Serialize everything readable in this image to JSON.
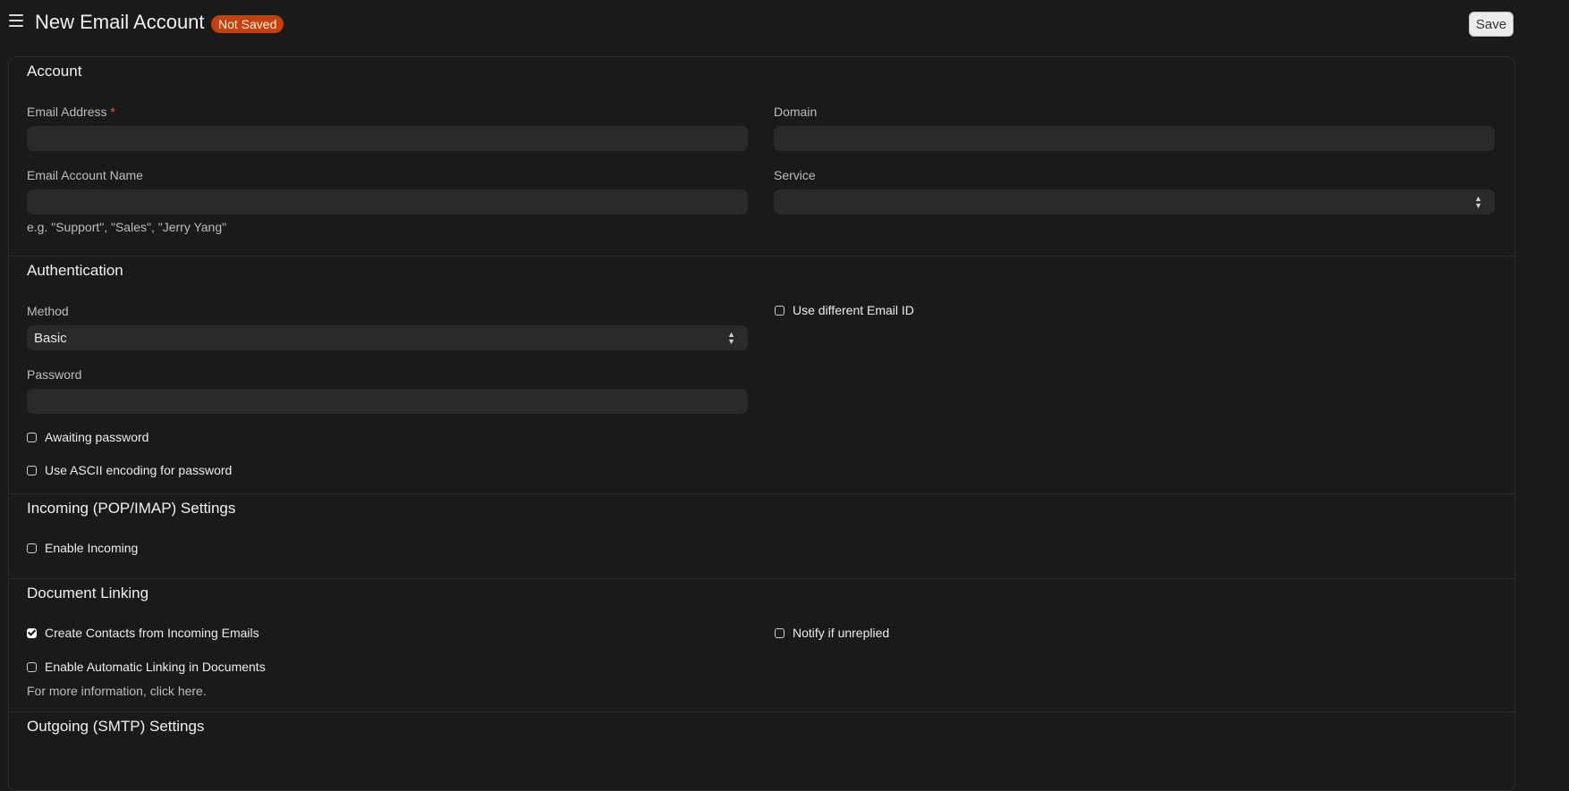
{
  "header": {
    "title": "New Email Account",
    "status": "Not Saved",
    "save_label": "Save"
  },
  "account": {
    "section_title": "Account",
    "email_address_label": "Email Address",
    "required_marker": "*",
    "email_address_value": "",
    "domain_label": "Domain",
    "domain_value": "",
    "account_name_label": "Email Account Name",
    "account_name_value": "",
    "account_name_help": "e.g. \"Support\", \"Sales\", \"Jerry Yang\"",
    "service_label": "Service",
    "service_value": ""
  },
  "authentication": {
    "section_title": "Authentication",
    "method_label": "Method",
    "method_value": "Basic",
    "password_label": "Password",
    "password_value": "",
    "awaiting_password_label": "Awaiting password",
    "awaiting_password_checked": false,
    "ascii_encoding_label": "Use ASCII encoding for password",
    "ascii_encoding_checked": false,
    "use_different_email_label": "Use different Email ID",
    "use_different_email_checked": false
  },
  "incoming": {
    "section_title": "Incoming (POP/IMAP) Settings",
    "enable_incoming_label": "Enable Incoming",
    "enable_incoming_checked": false
  },
  "document_linking": {
    "section_title": "Document Linking",
    "create_contacts_label": "Create Contacts from Incoming Emails",
    "create_contacts_checked": true,
    "automatic_linking_label": "Enable Automatic Linking in Documents",
    "automatic_linking_checked": false,
    "more_info_text": "For more information, click here.",
    "notify_unreplied_label": "Notify if unreplied",
    "notify_unreplied_checked": false
  },
  "outgoing": {
    "section_title": "Outgoing (SMTP) Settings"
  },
  "colors": {
    "background": "#1a1a1a",
    "input_background": "#2a2a2a",
    "status_badge": "#c2410c",
    "required": "#e0584a"
  },
  "icons": {
    "menu": "hamburger-menu-icon",
    "select_arrow": "up-down-chevron-icon",
    "checkmark": "checkmark-icon"
  }
}
